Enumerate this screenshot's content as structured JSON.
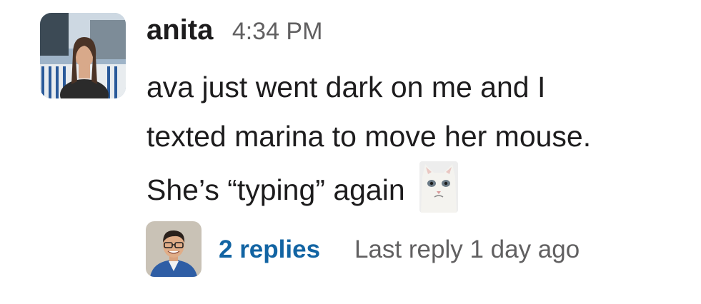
{
  "message": {
    "author": "anita",
    "timestamp": "4:34 PM",
    "body_lines": [
      "ava just went dark on me and I",
      "texted marina to move her mouse.",
      "She’s “typing” again"
    ],
    "emoji_icon": "sad-cat-emoji"
  },
  "thread": {
    "replies_label": "2 replies",
    "last_reply_label": "Last reply 1 day ago"
  },
  "colors": {
    "link": "#1264a3",
    "muted": "#616061",
    "text": "#1d1c1d"
  }
}
